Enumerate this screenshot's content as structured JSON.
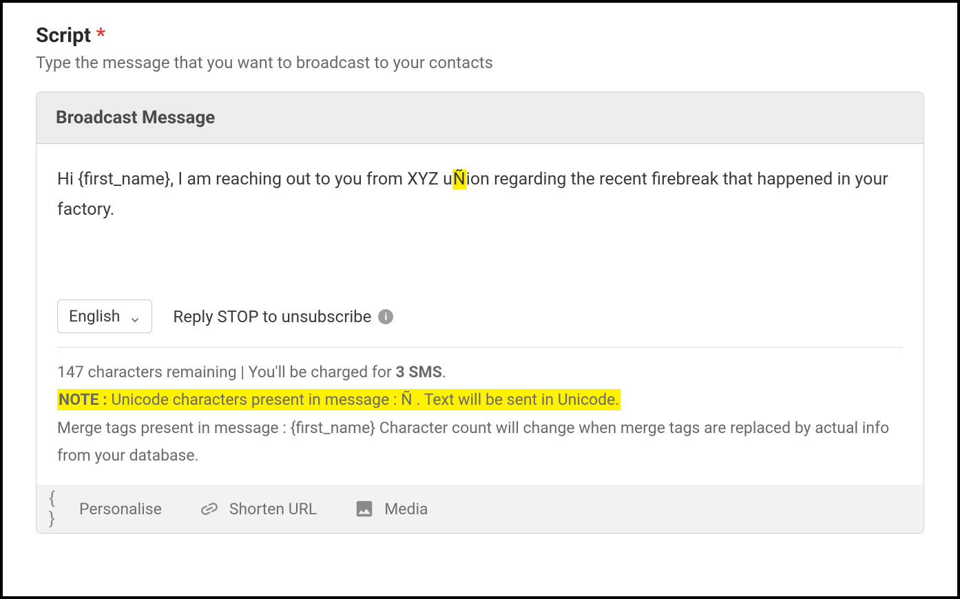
{
  "section": {
    "title": "Script",
    "required_marker": "*",
    "subtitle": "Type the message that you want to broadcast to your contacts"
  },
  "editor": {
    "header_title": "Broadcast Message",
    "message_prefix": "Hi {first_name}, I am reaching out to you from XYZ u",
    "message_highlight_char": "Ñ",
    "message_suffix": "ion regarding the recent firebreak that happened in your factory.",
    "language": "English",
    "unsubscribe_text": "Reply STOP to unsubscribe"
  },
  "status": {
    "char_remaining_text": "147 characters remaining | You'll be charged for ",
    "sms_count_text": "3 SMS",
    "period": ".",
    "note_label": "NOTE :",
    "note_body_prefix": " Unicode characters present in message : ",
    "note_unicode_chars": "Ñ",
    "note_body_suffix": " . Text will be sent in Unicode.",
    "merge_tags_text": "Merge tags present in message : {first_name} Character count will change when merge tags are replaced by actual info from your database."
  },
  "footer": {
    "personalise": "Personalise",
    "shorten_url": "Shorten URL",
    "media": "Media"
  }
}
